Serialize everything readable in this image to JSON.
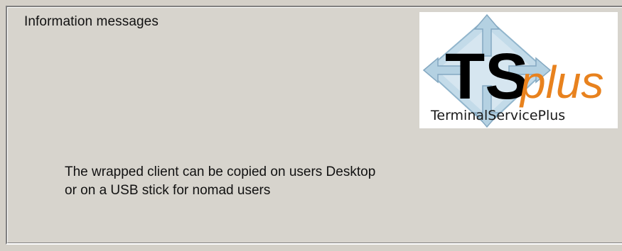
{
  "panel": {
    "title": "Information messages",
    "logo": {
      "brand_main": "TS",
      "brand_accent": "plus",
      "subtitle": "TerminalServicePlus",
      "accent_color": "#e8821e",
      "icon": "four-arrows-diamond-icon"
    },
    "message": {
      "line1": "The wrapped client can be copied on users Desktop",
      "line2": "or on a USB stick for nomad users"
    }
  }
}
